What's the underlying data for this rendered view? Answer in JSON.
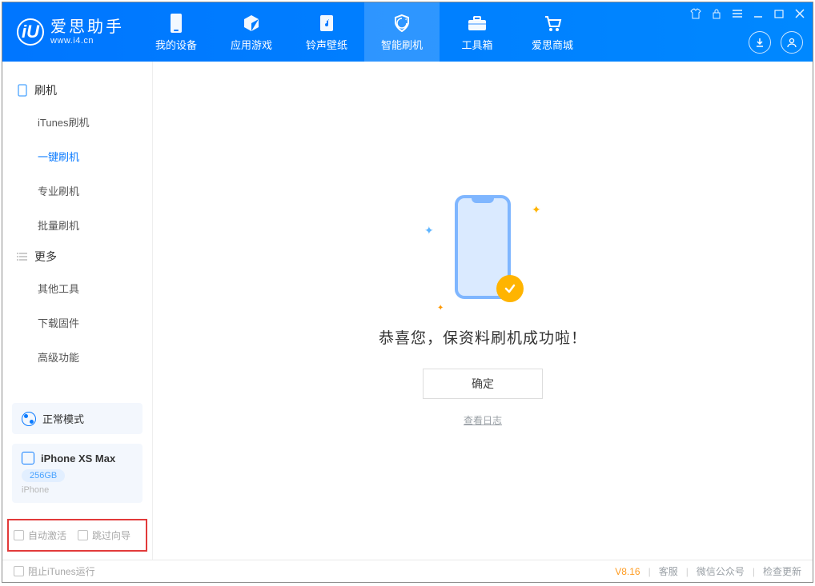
{
  "app": {
    "name_cn": "爱思助手",
    "name_en": "www.i4.cn",
    "logo_letter": "iU"
  },
  "topnav": [
    {
      "label": "我的设备",
      "icon": "phone-icon"
    },
    {
      "label": "应用游戏",
      "icon": "cube-icon"
    },
    {
      "label": "铃声壁纸",
      "icon": "music-icon"
    },
    {
      "label": "智能刷机",
      "icon": "shield-icon"
    },
    {
      "label": "工具箱",
      "icon": "toolbox-icon"
    },
    {
      "label": "爱思商城",
      "icon": "cart-icon"
    }
  ],
  "sidebar": {
    "group1": {
      "label": "刷机"
    },
    "items1": [
      {
        "label": "iTunes刷机"
      },
      {
        "label": "一键刷机",
        "selected": true
      },
      {
        "label": "专业刷机"
      },
      {
        "label": "批量刷机"
      }
    ],
    "group2": {
      "label": "更多"
    },
    "items2": [
      {
        "label": "其他工具"
      },
      {
        "label": "下载固件"
      },
      {
        "label": "高级功能"
      }
    ]
  },
  "mode": {
    "label": "正常模式"
  },
  "device": {
    "name": "iPhone XS Max",
    "storage": "256GB",
    "type": "iPhone"
  },
  "options": {
    "auto_activate": "自动激活",
    "skip_guide": "跳过向导"
  },
  "main": {
    "success_msg": "恭喜您，保资料刷机成功啦！",
    "ok_label": "确定",
    "log_link": "查看日志"
  },
  "footer": {
    "block_itunes": "阻止iTunes运行",
    "version": "V8.16",
    "links": [
      "客服",
      "微信公众号",
      "检查更新"
    ]
  }
}
